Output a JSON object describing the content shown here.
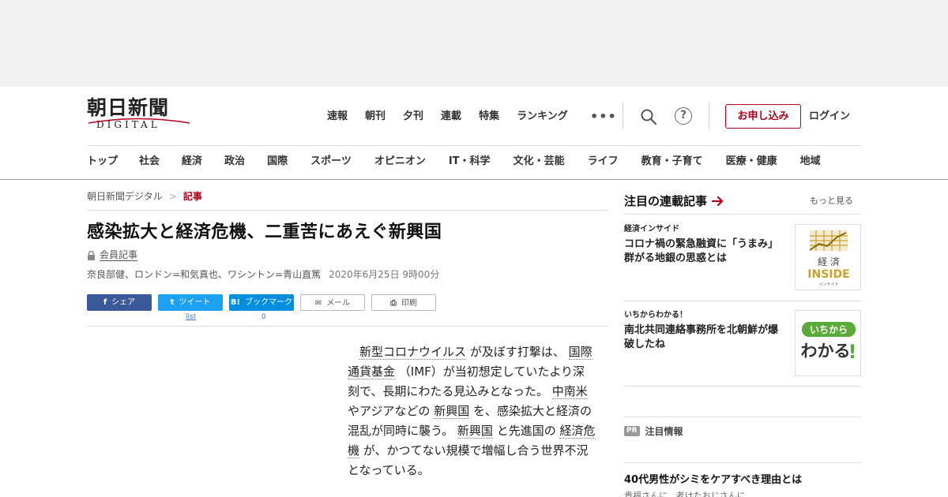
{
  "header": {
    "logo_main": "朝日新聞",
    "logo_sub": "DIGITAL",
    "top_nav": [
      "速報",
      "朝刊",
      "夕刊",
      "連載",
      "特集",
      "ランキング"
    ],
    "more_label": "•••",
    "help_label": "?",
    "apply_label": "お申し込み",
    "login_label": "ログイン"
  },
  "category_nav": [
    "トップ",
    "社会",
    "経済",
    "政治",
    "国際",
    "スポーツ",
    "オピニオン",
    "IT・科学",
    "文化・芸能",
    "ライフ",
    "教育・子育て",
    "医療・健康",
    "地域"
  ],
  "breadcrumb": {
    "home": "朝日新聞デジタル",
    "separator": ">",
    "current": "記事"
  },
  "article": {
    "title": "感染拡大と経済危機、二重苦にあえぐ新興国",
    "member_label": "会員記事",
    "byline": "奈良部健、ロンドン=和気真也、ワシントン=青山直篤",
    "date": "2020年6月25日 9時00分",
    "body": {
      "kw1": "新型コロナウイルス",
      "t1": "が及ぼす打撃は、",
      "kw2": "国際通貨基金",
      "t2": "（IMF）が当初想定していたより深刻で、長期にわたる見込みとなった。",
      "kw3": "中南米",
      "t3": "やアジアなどの",
      "kw4": "新興国",
      "t4": "を、感染拡大と経済の混乱が同時に襲う。",
      "kw5": "新興国",
      "t5": "と先進国の",
      "kw6": "経済危機",
      "t6": "が、かつてない規模で増幅し合う世界不況となっている。"
    }
  },
  "share": {
    "facebook": "シェア",
    "twitter": "ツイート",
    "hatena": "ブックマーク",
    "mail": "メール",
    "print": "印刷",
    "twitter_count": "list",
    "hatena_count": "0",
    "facebook_icon": "f",
    "twitter_icon": "t",
    "hatena_icon": "B!",
    "mail_icon": "✉",
    "print_icon": "⎙"
  },
  "sidebar": {
    "heading": "注目の連載記事",
    "more": "もっと見る",
    "items": [
      {
        "category": "経済インサイド",
        "headline": "コロナ禍の緊急融資に「うまみ」　群がる地銀の思惑とは",
        "thumb_line1": "経 済",
        "thumb_line2": "INSIDE",
        "thumb_line3": "インサイド"
      },
      {
        "category": "いちからわかる！",
        "headline": "南北共同連絡事務所を北朝鮮が爆破したね",
        "thumb_line1": "いちから",
        "thumb_line2": "わかる",
        "thumb_line3": "!"
      }
    ],
    "pr_badge": "PR",
    "pr_label": "注目情報",
    "pr_headline": "40代男性がシミをケアすべき理由とは",
    "pr_sub": "貴福さんに、老けたおじさんに"
  },
  "colors": {
    "brand_red": "#b3001b",
    "facebook": "#3b5998",
    "twitter": "#1da1f2",
    "hatena": "#008fde",
    "ichikara_green": "#5aaa3a",
    "inside_gold": "#c9a227"
  }
}
